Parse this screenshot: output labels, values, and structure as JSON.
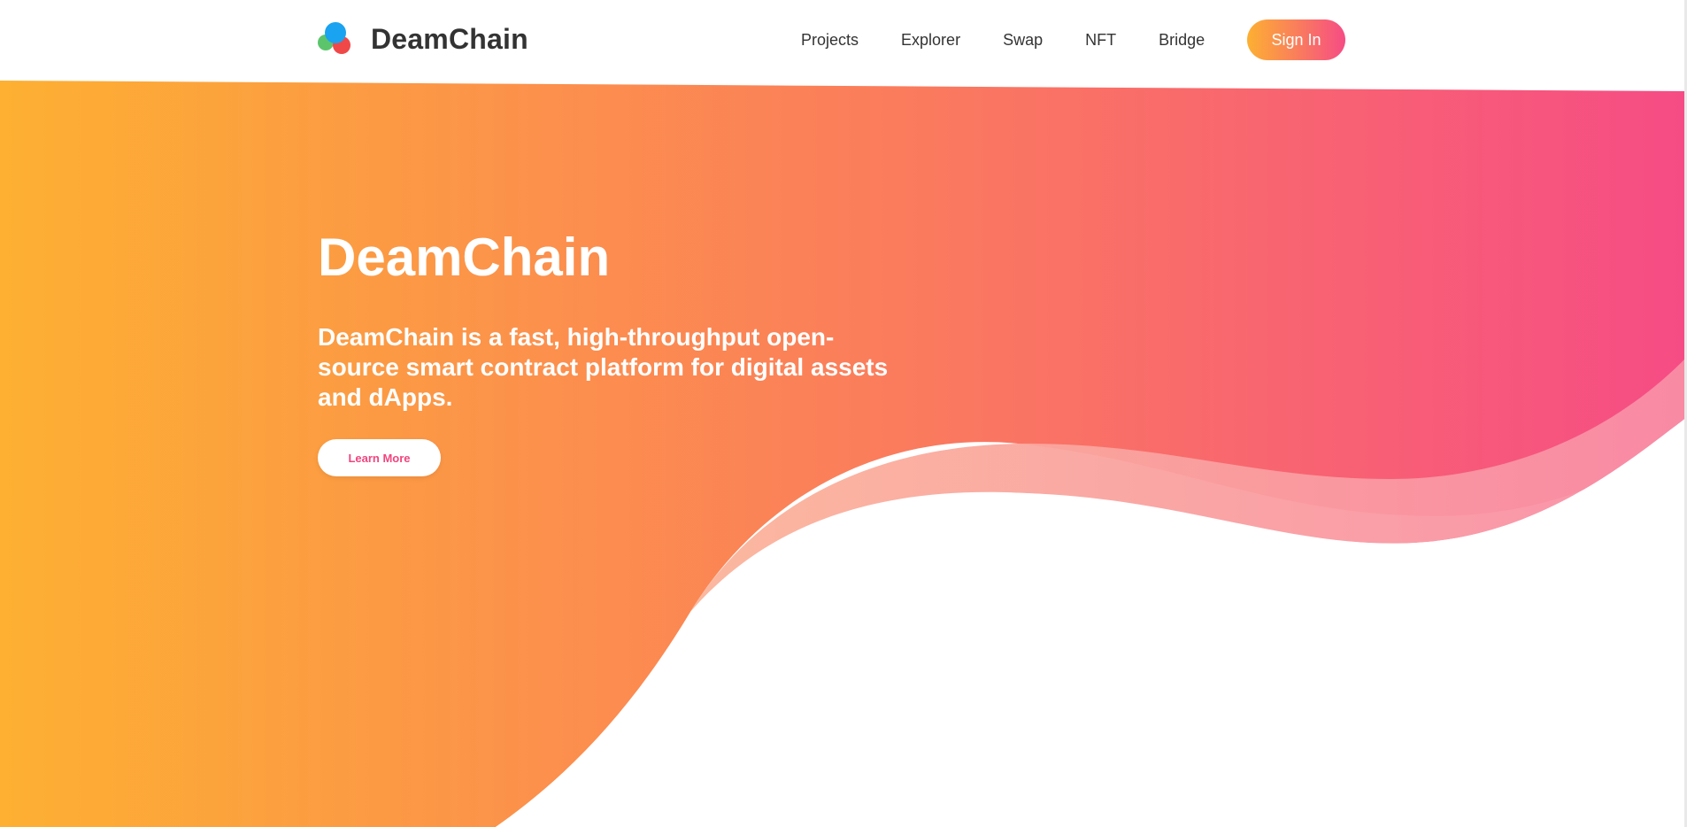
{
  "header": {
    "brand_name": "DeamChain",
    "logo_icon": "three-circles-logo-icon",
    "nav": [
      {
        "label": "Projects"
      },
      {
        "label": "Explorer"
      },
      {
        "label": "Swap"
      },
      {
        "label": "NFT"
      },
      {
        "label": "Bridge"
      }
    ],
    "signin_label": "Sign In"
  },
  "hero": {
    "title": "DeamChain",
    "description": "DeamChain is a fast, high-throughput open-source smart contract platform for digital assets and dApps.",
    "cta_label": "Learn More"
  },
  "colors": {
    "gradient_start": "#fdb032",
    "gradient_mid": "#fb7f5a",
    "gradient_end": "#f64c85",
    "wave_light": "#f98da6",
    "logo_blue": "#1aa3f0",
    "logo_red": "#f04848",
    "logo_green": "#5cc56c",
    "text_dark": "#333333",
    "cta_text": "#f2457e"
  }
}
